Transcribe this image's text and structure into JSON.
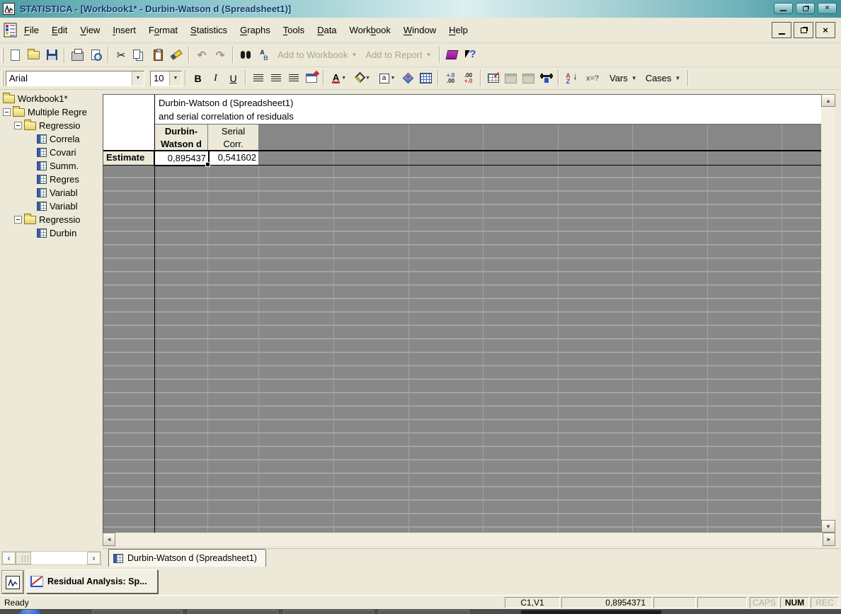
{
  "titlebar": {
    "title": "STATISTICA - [Workbook1* - Durbin-Watson d (Spreadsheet1)]"
  },
  "menubar": {
    "items": [
      {
        "label": "File",
        "u": 0
      },
      {
        "label": "Edit",
        "u": 0
      },
      {
        "label": "View",
        "u": 0
      },
      {
        "label": "Insert",
        "u": 0
      },
      {
        "label": "Format",
        "u": 1
      },
      {
        "label": "Statistics",
        "u": 0
      },
      {
        "label": "Graphs",
        "u": 0
      },
      {
        "label": "Tools",
        "u": 0
      },
      {
        "label": "Data",
        "u": 0
      },
      {
        "label": "Workbook",
        "u": 4
      },
      {
        "label": "Window",
        "u": 0
      },
      {
        "label": "Help",
        "u": 0
      }
    ]
  },
  "toolbar_main": {
    "add_to_workbook": "Add to Workbook",
    "add_to_report": "Add to Report"
  },
  "toolbar_format": {
    "font_name": "Arial",
    "font_size": "10",
    "bold": "B",
    "italic": "I",
    "underline": "U",
    "font_color_glyph": "A",
    "box_a_glyph": "a",
    "sort_a": "A",
    "sort_z": "Z",
    "var_spec": "x=?",
    "vars": "Vars",
    "cases": "Cases"
  },
  "tree": {
    "items": [
      {
        "label": "Workbook1*",
        "depth": 0,
        "icon": "folder",
        "expand": false
      },
      {
        "label": "Multiple Regre",
        "depth": 1,
        "icon": "folder",
        "expand": true
      },
      {
        "label": "Regressio",
        "depth": 2,
        "icon": "folder",
        "expand": true
      },
      {
        "label": "Correla",
        "depth": 3,
        "icon": "table",
        "expand": false
      },
      {
        "label": "Covari",
        "depth": 3,
        "icon": "table",
        "expand": false
      },
      {
        "label": "Summ.",
        "depth": 3,
        "icon": "table",
        "expand": false
      },
      {
        "label": "Regres",
        "depth": 3,
        "icon": "table",
        "expand": false
      },
      {
        "label": "Variabl",
        "depth": 3,
        "icon": "table",
        "expand": false
      },
      {
        "label": "Variabl",
        "depth": 3,
        "icon": "table",
        "expand": false
      },
      {
        "label": "Regressio",
        "depth": 2,
        "icon": "folder",
        "expand": true
      },
      {
        "label": "Durbin",
        "depth": 3,
        "icon": "table",
        "expand": false
      }
    ]
  },
  "sheet": {
    "title_line1": "Durbin-Watson d (Spreadsheet1)",
    "title_line2": "and serial correlation of residuals",
    "col1_line1": "Durbin-",
    "col1_line2": "Watson d",
    "col2_line1": "Serial",
    "col2_line2": "Corr.",
    "row_header": "Estimate",
    "value1": "0,895437",
    "value2": "0,541602"
  },
  "tabs": {
    "active_tab": "Durbin-Watson d (Spreadsheet1)"
  },
  "taskbar": {
    "residual_button": "Residual Analysis: Sp..."
  },
  "statusbar": {
    "ready": "Ready",
    "cell_ref": "C1,V1",
    "cell_value": "0,8954371",
    "caps": "CAPS",
    "num": "NUM",
    "rec": "REC"
  },
  "colors": {
    "titlebar_teal": "#5aa7ad",
    "grid_gray": "#878787",
    "beige": "#ece9d8",
    "title_text_navy": "#173a72"
  }
}
